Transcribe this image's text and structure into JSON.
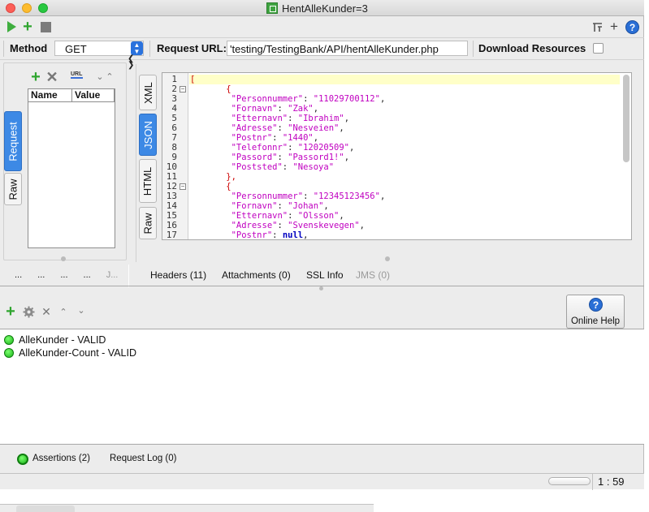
{
  "window": {
    "title": "HentAlleKunder=3"
  },
  "toolbar": {
    "run": "play-icon",
    "add": "+",
    "stop": "stop-icon",
    "right_plus": "+",
    "help": "?"
  },
  "request_bar": {
    "method_label": "Method",
    "method_value": "GET",
    "url_label": "Request URL:",
    "url_value": "'testing/TestingBank/API/hentAlleKunder.php",
    "download_label": "Download Resources"
  },
  "left_tabs": {
    "request": "Request",
    "raw": "Raw"
  },
  "params": {
    "col_name": "Name",
    "col_value": "Value"
  },
  "response_tabs": {
    "xml": "XML",
    "json": "JSON",
    "html": "HTML",
    "raw": "Raw"
  },
  "json_lines": [
    {
      "n": "1",
      "text": "["
    },
    {
      "n": "2",
      "text": "   {"
    },
    {
      "n": "3",
      "key": "\"Personnummer\"",
      "val": "\"11029700112\"",
      "end": ","
    },
    {
      "n": "4",
      "key": "\"Fornavn\"",
      "val": "\"Zak\"",
      "end": ","
    },
    {
      "n": "5",
      "key": "\"Etternavn\"",
      "val": "\"Ibrahim\"",
      "end": ","
    },
    {
      "n": "6",
      "key": "\"Adresse\"",
      "val": "\"Nesveien\"",
      "end": ","
    },
    {
      "n": "7",
      "key": "\"Postnr\"",
      "val": "\"1440\"",
      "end": ","
    },
    {
      "n": "8",
      "key": "\"Telefonnr\"",
      "val": "\"12020509\"",
      "end": ","
    },
    {
      "n": "9",
      "key": "\"Passord\"",
      "val": "\"Passord1!\"",
      "end": ","
    },
    {
      "n": "10",
      "key": "\"Poststed\"",
      "val": "\"Nesoya\"",
      "end": ""
    },
    {
      "n": "11",
      "text": "   },"
    },
    {
      "n": "12",
      "text": "   {"
    },
    {
      "n": "13",
      "key": "\"Personnummer\"",
      "val": "\"12345123456\"",
      "end": ","
    },
    {
      "n": "14",
      "key": "\"Fornavn\"",
      "val": "\"Johan\"",
      "end": ","
    },
    {
      "n": "15",
      "key": "\"Etternavn\"",
      "val": "\"Olsson\"",
      "end": ","
    },
    {
      "n": "16",
      "key": "\"Adresse\"",
      "val": "\"Svenskevegen\"",
      "end": ","
    },
    {
      "n": "17",
      "key": "\"Postnr\"",
      "val": "null",
      "end": ","
    }
  ],
  "bottom_left_dots": [
    "...",
    "...",
    "...",
    "...",
    "J..."
  ],
  "bottom_tabs": {
    "headers": "Headers (11)",
    "attachments": "Attachments (0)",
    "ssl": "SSL Info",
    "jms": "JMS (0)"
  },
  "assertions": [
    {
      "label": "AlleKunder - VALID",
      "status": "valid"
    },
    {
      "label": "AlleKunder-Count - VALID",
      "status": "valid"
    }
  ],
  "online_help": "Online Help",
  "footer_tabs": {
    "assertions": "Assertions (2)",
    "request_log": "Request Log (0)"
  },
  "status": {
    "position": "1 : 59"
  },
  "colors": {
    "valid": "#19b319",
    "json_key": "#c000c0",
    "null_kw": "#0000c0",
    "active_tab": "#3d89e5"
  }
}
